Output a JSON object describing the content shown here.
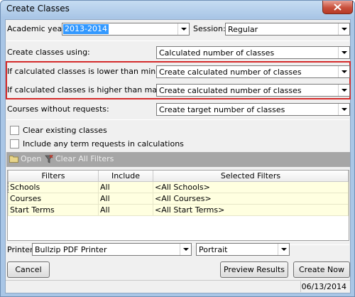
{
  "window": {
    "title": "Create Classes"
  },
  "academic_year": {
    "label": "Academic year:",
    "value": "2013-2014"
  },
  "session": {
    "label": "Session:",
    "value": "Regular"
  },
  "create_using": {
    "label": "Create classes using:",
    "value": "Calculated number of classes"
  },
  "lower_than_min": {
    "label": "If calculated classes is lower than minimum:",
    "value": "Create calculated number of classes"
  },
  "higher_than_max": {
    "label": "If calculated classes is higher than maximum:",
    "value": "Create calculated number of classes"
  },
  "without_requests": {
    "label": "Courses without requests:",
    "value": "Create target number of classes"
  },
  "options": {
    "clear_existing": "Clear existing classes",
    "include_term": "Include any term requests in calculations"
  },
  "toolbar": {
    "open": "Open",
    "clear_filters": "Clear All Filters"
  },
  "grid": {
    "columns": [
      "Filters",
      "Include",
      "Selected Filters"
    ],
    "rows": [
      [
        "Schools",
        "All",
        "<All Schools>"
      ],
      [
        "Courses",
        "All",
        "<All Courses>"
      ],
      [
        "Start Terms",
        "All",
        "<All Start Terms>"
      ]
    ]
  },
  "printer": {
    "label": "Printer:",
    "value": "Bullzip PDF Printer",
    "orientation": "Portrait"
  },
  "buttons": {
    "cancel": "Cancel",
    "preview": "Preview Results",
    "create": "Create Now"
  },
  "status": {
    "date": "06/13/2014"
  },
  "colors": {
    "highlight_box": "#d42b2b",
    "selection": "#3399ff",
    "grid_row": "#ffffe0"
  }
}
